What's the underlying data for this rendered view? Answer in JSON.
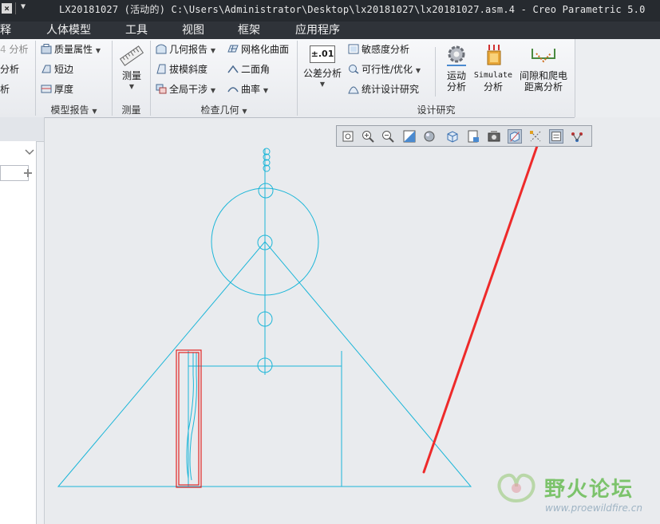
{
  "titlebar": {
    "close_glyph": "×",
    "quick_access_glyph": "▼",
    "title": "LX20181027 (活动的) C:\\Users\\Administrator\\Desktop\\lx20181027\\lx20181027.asm.4 - Creo Parametric 5.0"
  },
  "tabs": [
    "释",
    "人体模型",
    "工具",
    "视图",
    "框架",
    "应用程序"
  ],
  "ribbon": {
    "col1": [
      "分析",
      "分析",
      "析"
    ],
    "model_report": {
      "items": [
        "质量属性",
        "短边",
        "厚度"
      ],
      "label": "模型报告"
    },
    "measure": {
      "button": "测量",
      "label": "测量"
    },
    "inspect_geometry": {
      "items": [
        "几何报告",
        "拔模斜度",
        "全局干涉",
        "网格化曲面",
        "二面角",
        "曲率"
      ],
      "label": "检查几何"
    },
    "design_study": {
      "tolerance_icon_text": "±.01",
      "tolerance_label": "公差分析",
      "items": [
        "敏感度分析",
        "可行性/优化",
        "统计设计研究"
      ],
      "motion_label_1": "运动",
      "motion_label_2": "分析",
      "simulate_label_1": "Simulate",
      "simulate_label_2": "分析",
      "clearance_label_1": "间隙和爬电",
      "clearance_label_2": "距离分析",
      "label": "设计研究"
    }
  },
  "watermark": {
    "name": "野火论坛",
    "url": "www.proewildfire.cn"
  }
}
